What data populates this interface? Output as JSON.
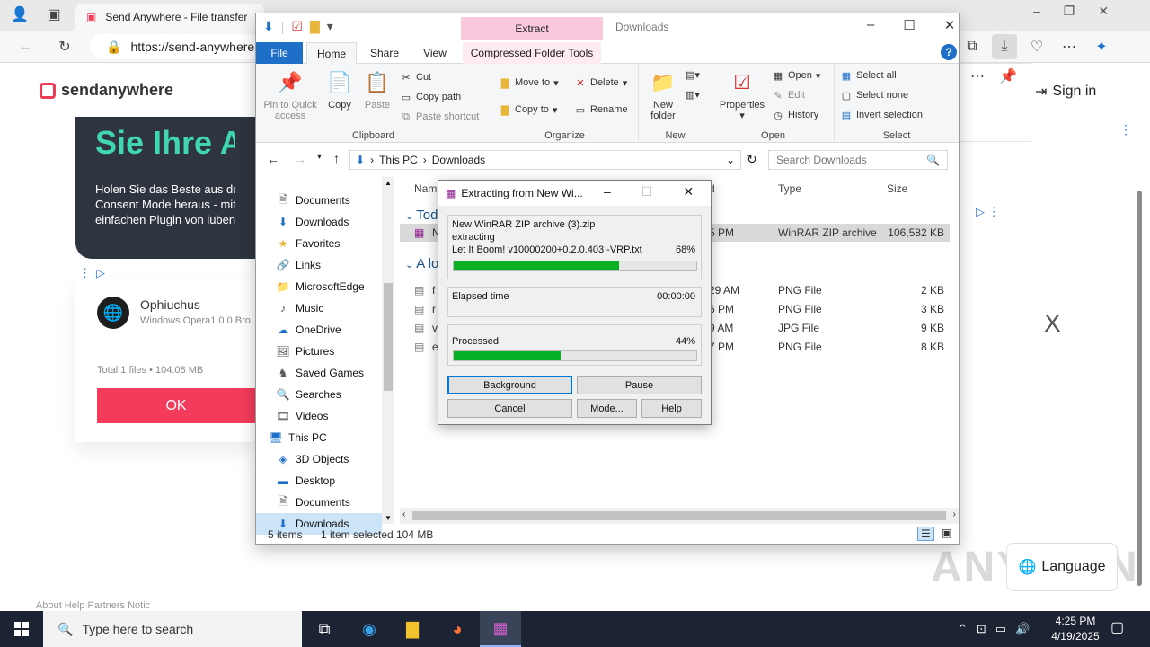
{
  "browser": {
    "tab_title": "Send Anywhere - File transfer",
    "url": "https://send-anywhere",
    "sign_in": "Sign in",
    "logo_text": "sendanywhere",
    "promo_heading": "Sie Ihre A",
    "promo_lines": [
      "Holen Sie das Beste aus dem",
      "Consent Mode heraus - mit de",
      "einfachen Plugin von iubenda"
    ],
    "app_name": "Ophiuchus",
    "app_sub": "Windows Opera1.0.0 Bro",
    "total": "Total 1 files • 104.08 MB",
    "ok": "OK",
    "language": "Language",
    "watermark": "ANY RUN",
    "close_x": "X",
    "bottom_text": "About  Help  Partners  Notic"
  },
  "explorer": {
    "extract_tab": "Extract",
    "window_title": "Downloads",
    "tabs": {
      "file": "File",
      "home": "Home",
      "share": "Share",
      "view": "View",
      "cft": "Compressed Folder Tools"
    },
    "ribbon": {
      "clipboard": {
        "label": "Clipboard",
        "pin": "Pin to Quick access",
        "copy": "Copy",
        "paste": "Paste",
        "cut": "Cut",
        "copy_path": "Copy path",
        "paste_shortcut": "Paste shortcut"
      },
      "organize": {
        "label": "Organize",
        "move_to": "Move to",
        "copy_to": "Copy to",
        "delete": "Delete",
        "rename": "Rename"
      },
      "new": {
        "label": "New",
        "new_folder": "New folder"
      },
      "open": {
        "label": "Open",
        "properties": "Properties",
        "open": "Open",
        "edit": "Edit",
        "history": "History"
      },
      "select": {
        "label": "Select",
        "select_all": "Select all",
        "select_none": "Select none",
        "invert": "Invert selection"
      }
    },
    "path": [
      "This PC",
      "Downloads"
    ],
    "search_placeholder": "Search Downloads",
    "nav": [
      {
        "label": "Documents",
        "icon": "documents-icon"
      },
      {
        "label": "Downloads",
        "icon": "downloads-icon"
      },
      {
        "label": "Favorites",
        "icon": "favorites-icon"
      },
      {
        "label": "Links",
        "icon": "links-icon"
      },
      {
        "label": "MicrosoftEdge",
        "icon": "folder-icon"
      },
      {
        "label": "Music",
        "icon": "music-icon"
      },
      {
        "label": "OneDrive",
        "icon": "onedrive-icon"
      },
      {
        "label": "Pictures",
        "icon": "pictures-icon"
      },
      {
        "label": "Saved Games",
        "icon": "saved-games-icon"
      },
      {
        "label": "Searches",
        "icon": "searches-icon"
      },
      {
        "label": "Videos",
        "icon": "videos-icon"
      },
      {
        "label": "This PC",
        "icon": "this-pc-icon"
      },
      {
        "label": "3D Objects",
        "icon": "3d-objects-icon"
      },
      {
        "label": "Desktop",
        "icon": "desktop-icon"
      },
      {
        "label": "Documents",
        "icon": "documents-icon"
      },
      {
        "label": "Downloads",
        "icon": "downloads-icon"
      }
    ],
    "columns": {
      "name": "Nam",
      "date": "d",
      "type": "Type",
      "size": "Size"
    },
    "groups": [
      "Tod",
      "A lo"
    ],
    "files": [
      {
        "name": "N",
        "date": "5 PM",
        "type": "WinRAR ZIP archive",
        "size": "106,582 KB",
        "selected": true
      },
      {
        "name": "f",
        "date": "29 AM",
        "type": "PNG File",
        "size": "2 KB"
      },
      {
        "name": "r",
        "date": "6 PM",
        "type": "PNG File",
        "size": "3 KB"
      },
      {
        "name": "v",
        "date": "9 AM",
        "type": "JPG File",
        "size": "9 KB"
      },
      {
        "name": "e",
        "date": "7 PM",
        "type": "PNG File",
        "size": "8 KB"
      }
    ],
    "status": {
      "items": "5 items",
      "selected": "1 item selected",
      "size": "104 MB"
    }
  },
  "rar": {
    "title": "Extracting from New Wi...",
    "archive": "New WinRAR ZIP archive (3).zip",
    "action": "extracting",
    "current_file": "Let It Boom! v10000200+0.2.0.403 -VRP.txt",
    "file_percent_text": "68%",
    "file_percent": 68,
    "elapsed_label": "Elapsed time",
    "elapsed": "00:00:00",
    "processed_label": "Processed",
    "processed_text": "44%",
    "processed": 44,
    "buttons": {
      "background": "Background",
      "pause": "Pause",
      "cancel": "Cancel",
      "mode": "Mode...",
      "help": "Help"
    }
  },
  "taskbar": {
    "search_placeholder": "Type here to search",
    "time": "4:25 PM",
    "date": "4/19/2025"
  },
  "colors": {
    "accent": "#1e6fc8",
    "progress": "#06b025",
    "brand": "#f53b5c",
    "taskbar": "#1c2333"
  }
}
